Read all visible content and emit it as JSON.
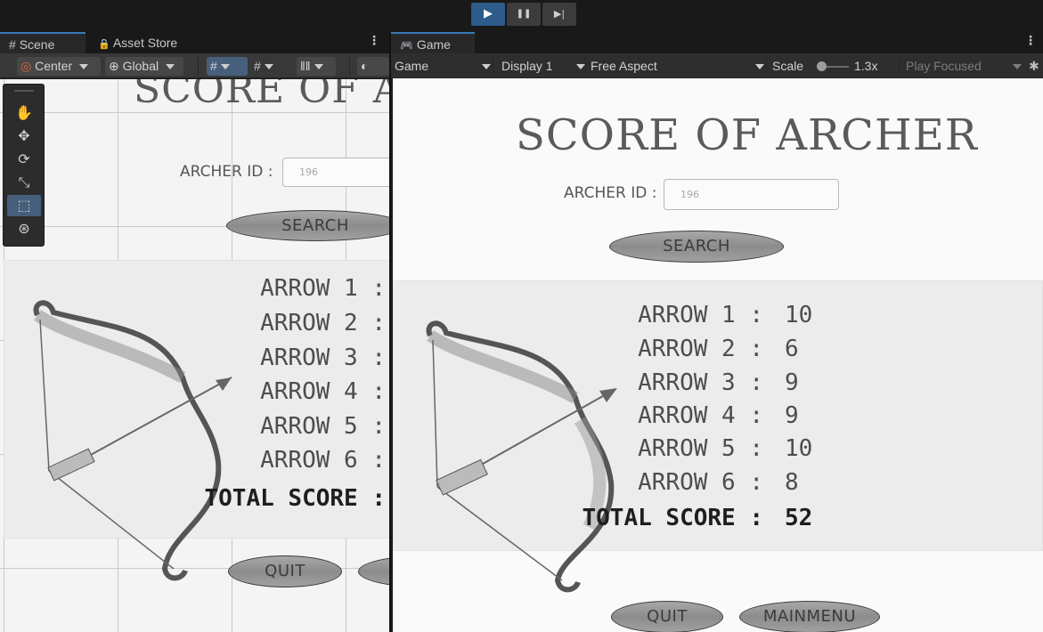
{
  "playbar": {
    "play": "▶",
    "pause": "❚❚",
    "step": "▶|"
  },
  "scene_panel": {
    "tabs": [
      {
        "icon": "#",
        "label": "Scene"
      },
      {
        "icon": "🔒",
        "label": "Asset Store"
      }
    ],
    "kebab": "⋮",
    "toolbar": {
      "pivot": "Center",
      "space": "Global"
    }
  },
  "game_panel": {
    "tab": {
      "icon": "🎮",
      "label": "Game"
    },
    "kebab": "⋮",
    "toolbar": {
      "mode": "Game",
      "display": "Display 1",
      "aspect": "Free Aspect",
      "scale_label": "Scale",
      "scale_value": "1.3x",
      "play_focused": "Play Focused"
    }
  },
  "game_ui": {
    "title": "SCORE OF ARCHER",
    "archer_id_label": "ARCHER ID :",
    "archer_id_value": "196",
    "search_button": "SEARCH",
    "rows": [
      {
        "label": "ARROW 1 :",
        "value": "10"
      },
      {
        "label": "ARROW 2 :",
        "value": "6"
      },
      {
        "label": "ARROW 3 :",
        "value": "9"
      },
      {
        "label": "ARROW 4 :",
        "value": "9"
      },
      {
        "label": "ARROW 5 :",
        "value": "10"
      },
      {
        "label": "ARROW 6 :",
        "value": "8"
      }
    ],
    "total_label": "TOTAL SCORE :",
    "total_value": "52",
    "quit_button": "QUIT",
    "main_menu_button": "MAINMENU"
  },
  "colors": {
    "accent_blue": "#2d5b8a",
    "panel_dark": "#1e1e1e",
    "toolbar": "#383838"
  }
}
